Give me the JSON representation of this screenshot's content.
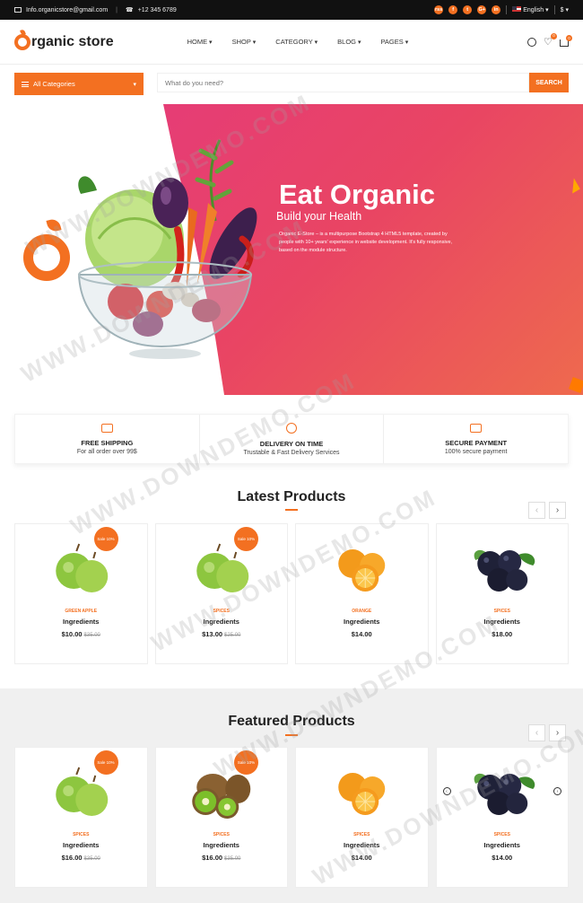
{
  "topbar": {
    "email": "Info.organicstore@gmail.com",
    "phone": "+12 345 6789",
    "social": [
      "rss",
      "f",
      "t",
      "G+",
      "in"
    ],
    "language": "English",
    "currency": "$"
  },
  "header": {
    "logo_text": "rganic store",
    "nav": [
      "HOME",
      "SHOP",
      "CATEGORY",
      "BLOG",
      "PAGES"
    ],
    "cart_count": "0"
  },
  "search": {
    "categories_label": "All Categories",
    "placeholder": "What do you need?",
    "button": "SEARCH"
  },
  "hero": {
    "title": "Eat Organic",
    "subtitle": "Build your Health",
    "description": "Organic E-Store – is a multipurpose Bootstrap 4 HTML5 template, created by people with 10+ years' experience in website development. It's fully responsive, based on the module structure."
  },
  "features": [
    {
      "title": "FREE SHIPPING",
      "desc": "For all order over 99$"
    },
    {
      "title": "DELIVERY ON TIME",
      "desc": "Trustable & Fast Delivery Services"
    },
    {
      "title": "SECURE PAYMENT",
      "desc": "100% secure payment"
    }
  ],
  "latest": {
    "title": "Latest Products",
    "products": [
      {
        "category": "GREEN APPLE",
        "name": "Ingredients",
        "price": "$10.00",
        "old": "$35.00",
        "sale": "Sale 10%",
        "image": "apple"
      },
      {
        "category": "SPICES",
        "name": "Ingredients",
        "price": "$13.00",
        "old": "$25.00",
        "sale": "Sale 10%",
        "image": "apple"
      },
      {
        "category": "ORANGE",
        "name": "Ingredients",
        "price": "$14.00",
        "old": "",
        "sale": "",
        "image": "orange"
      },
      {
        "category": "SPICES",
        "name": "Ingredients",
        "price": "$18.00",
        "old": "",
        "sale": "",
        "image": "blueberry"
      }
    ]
  },
  "featured": {
    "title": "Featured Products",
    "products": [
      {
        "category": "SPICES",
        "name": "Ingredients",
        "price": "$16.00",
        "old": "$35.00",
        "sale": "Sale 10%",
        "image": "apple"
      },
      {
        "category": "SPICES",
        "name": "Ingredients",
        "price": "$16.00",
        "old": "$35.00",
        "sale": "Sale 10%",
        "image": "kiwi"
      },
      {
        "category": "SPICES",
        "name": "Ingredients",
        "price": "$14.00",
        "old": "",
        "sale": "",
        "image": "orange"
      },
      {
        "category": "SPICES",
        "name": "Ingredients",
        "price": "$14.00",
        "old": "",
        "sale": "",
        "image": "blueberry"
      }
    ]
  },
  "watermark": "WWW.DOWNDEMO.COM",
  "colors": {
    "accent": "#f37021",
    "hero_pink": "#e4387f"
  }
}
